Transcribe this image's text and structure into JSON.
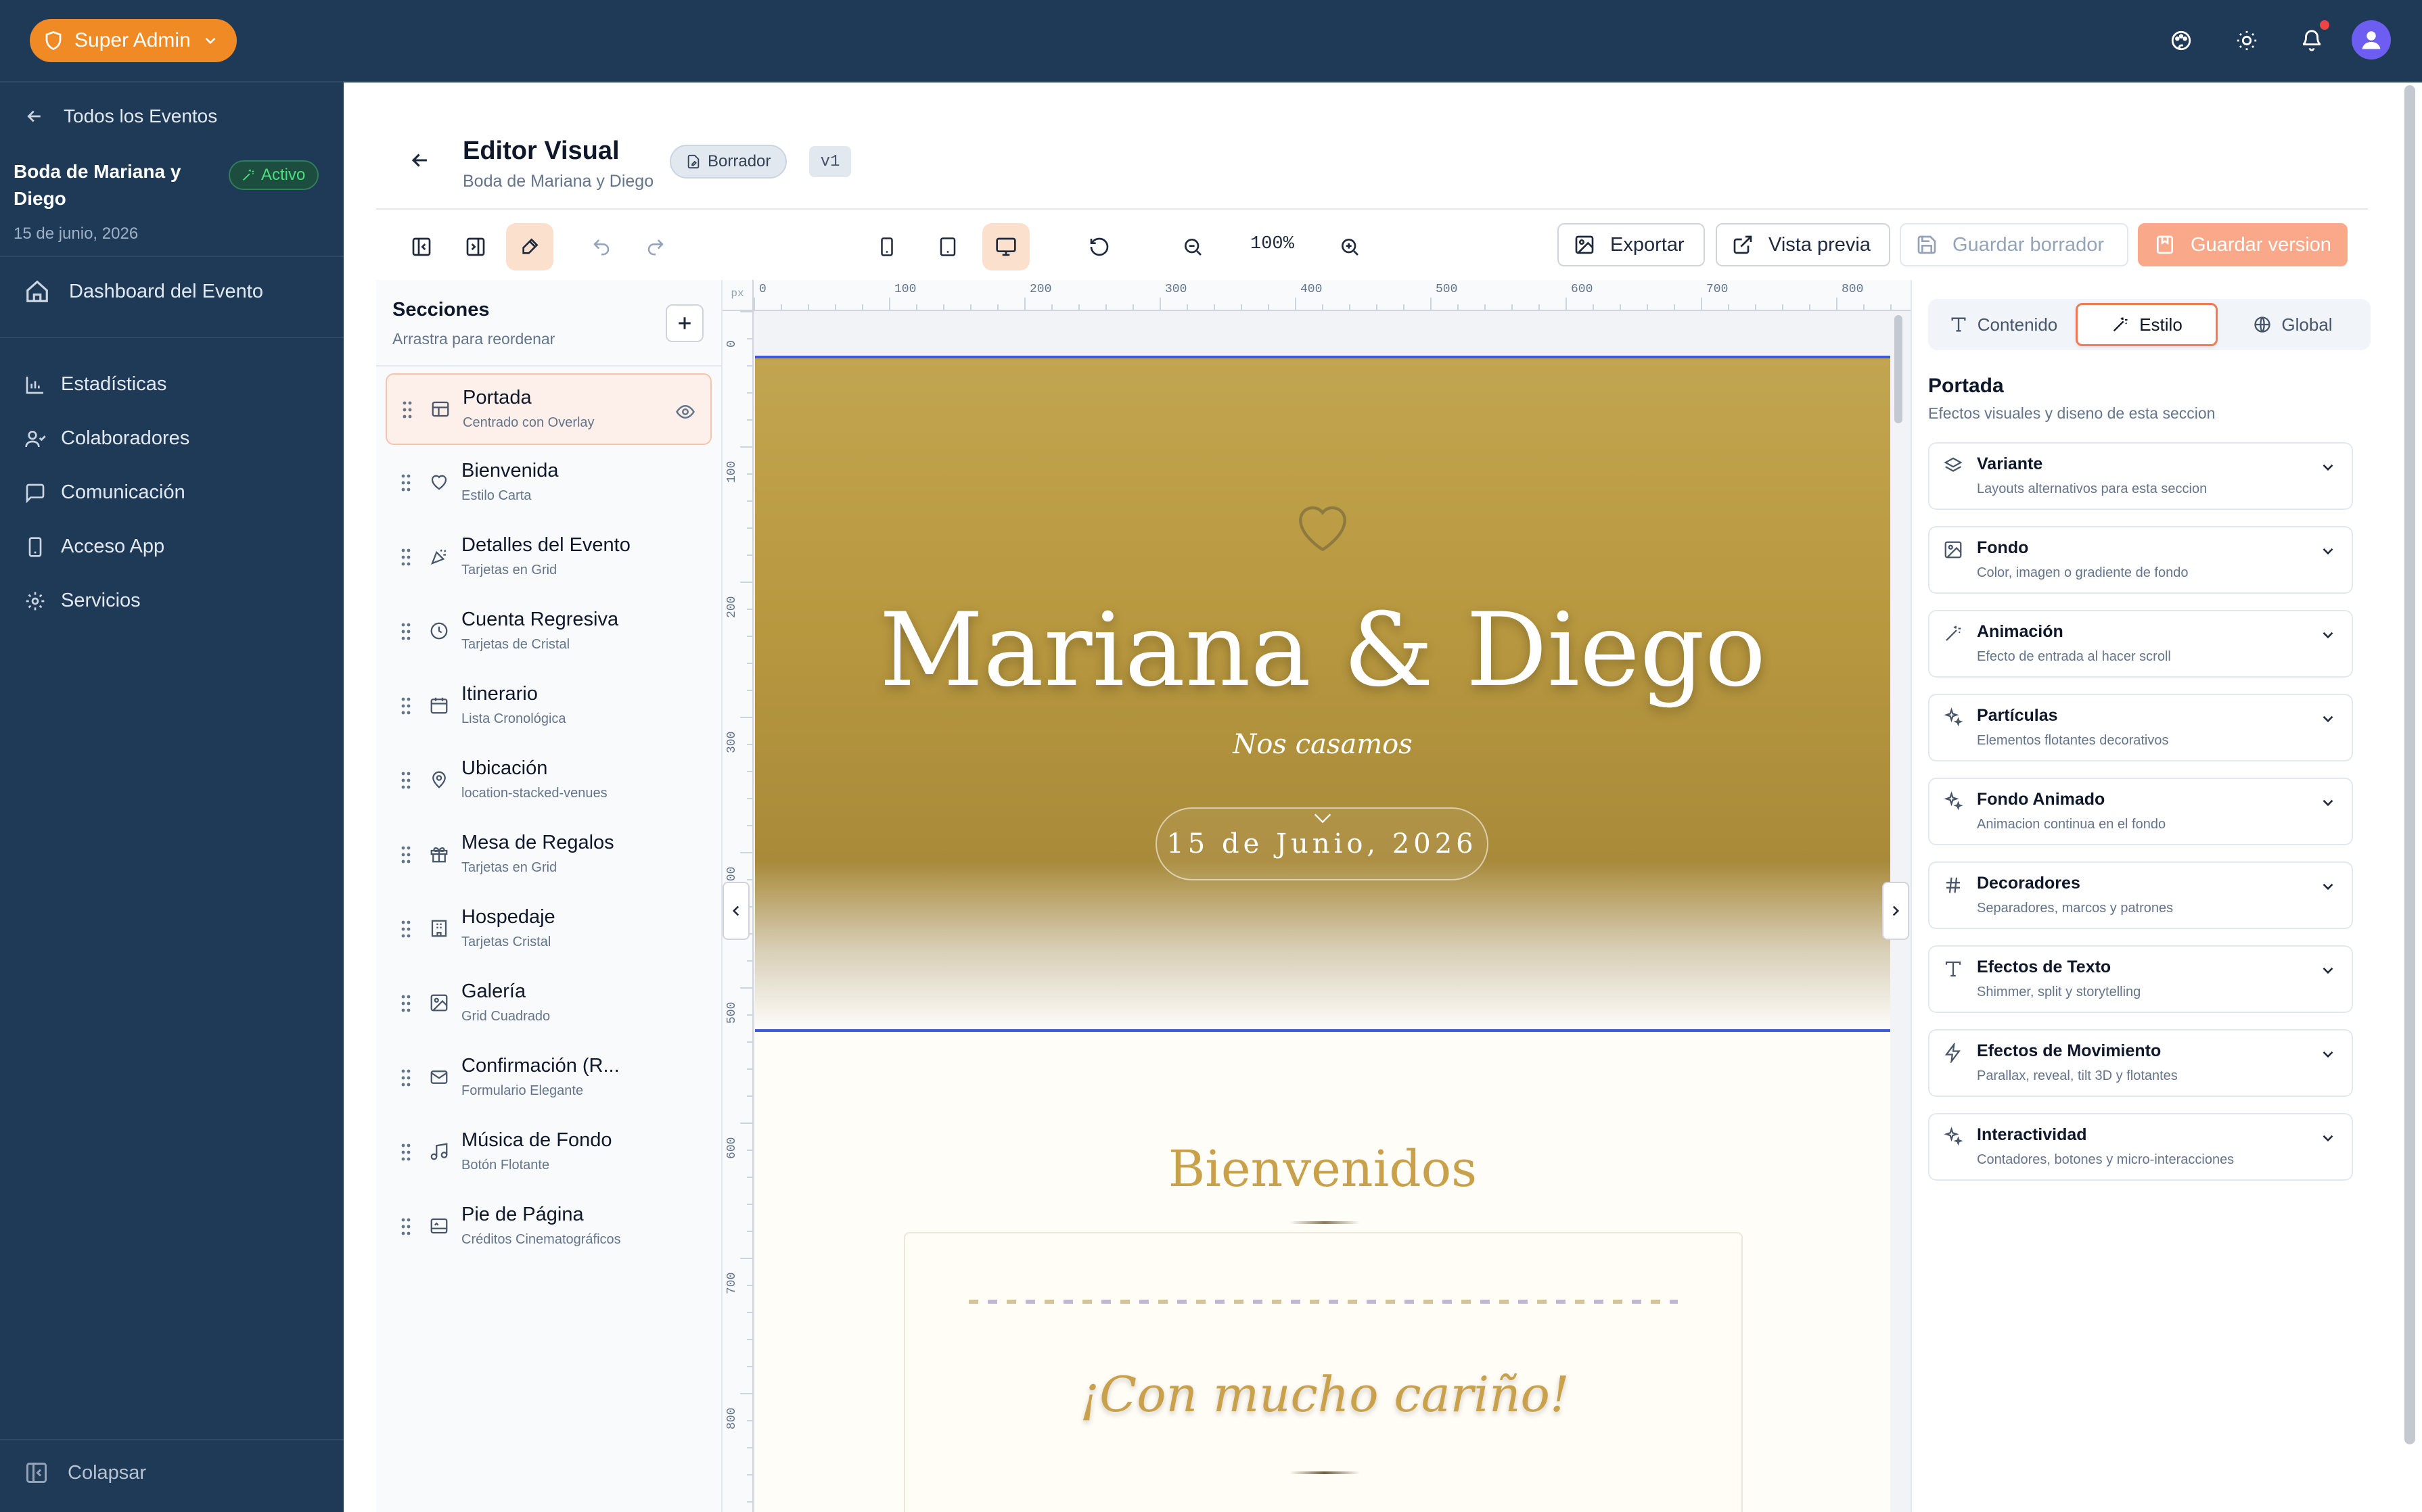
{
  "topbar": {
    "admin_label": "Super Admin",
    "icons": [
      "palette-icon",
      "sun-icon",
      "bell-icon",
      "user-avatar"
    ]
  },
  "sidebar": {
    "back_label": "Todos los Eventos",
    "event_name": "Boda de Mariana y Diego",
    "status": "Activo",
    "event_date": "15 de junio, 2026",
    "dashboard_label": "Dashboard del Evento",
    "items": [
      {
        "label": "Estadísticas",
        "icon": "chart-icon"
      },
      {
        "label": "Colaboradores",
        "icon": "users-icon"
      },
      {
        "label": "Comunicación",
        "icon": "message-icon"
      },
      {
        "label": "Acceso App",
        "icon": "phone-icon"
      },
      {
        "label": "Servicios",
        "icon": "gear-icon"
      }
    ],
    "collapse_label": "Colapsar"
  },
  "editor": {
    "title": "Editor Visual",
    "subtitle": "Boda de Mariana y Diego",
    "status_chip": "Borrador",
    "version_chip": "v1",
    "zoom": "100%",
    "export_label": "Exportar",
    "preview_label": "Vista previa",
    "save_draft_label": "Guardar borrador",
    "save_version_label": "Guardar version"
  },
  "sections_panel": {
    "title": "Secciones",
    "subtitle": "Arrastra para reordenar",
    "items": [
      {
        "name": "Portada",
        "variant": "Centrado con Overlay",
        "icon": "layout-icon",
        "selected": true
      },
      {
        "name": "Bienvenida",
        "variant": "Estilo Carta",
        "icon": "heart-icon"
      },
      {
        "name": "Detalles del Evento",
        "variant": "Tarjetas en Grid",
        "icon": "party-icon"
      },
      {
        "name": "Cuenta Regresiva",
        "variant": "Tarjetas de Cristal",
        "icon": "clock-icon"
      },
      {
        "name": "Itinerario",
        "variant": "Lista Cronológica",
        "icon": "calendar-icon"
      },
      {
        "name": "Ubicación",
        "variant": "location-stacked-venues",
        "icon": "pin-icon"
      },
      {
        "name": "Mesa de Regalos",
        "variant": "Tarjetas en Grid",
        "icon": "gift-icon"
      },
      {
        "name": "Hospedaje",
        "variant": "Tarjetas Cristal",
        "icon": "building-icon"
      },
      {
        "name": "Galería",
        "variant": "Grid Cuadrado",
        "icon": "image-icon"
      },
      {
        "name": "Confirmación (R...",
        "variant": "Formulario Elegante",
        "icon": "mail-icon"
      },
      {
        "name": "Música de Fondo",
        "variant": "Botón Flotante",
        "icon": "music-icon"
      },
      {
        "name": "Pie de Página",
        "variant": "Créditos Cinematográficos",
        "icon": "footer-icon"
      }
    ]
  },
  "canvas": {
    "ruler_unit": "px",
    "ruler_top": [
      "0",
      "100",
      "200",
      "300",
      "400",
      "500",
      "600",
      "700",
      "800"
    ],
    "ruler_left": [
      "0",
      "100",
      "200",
      "300",
      "400",
      "500",
      "600",
      "700",
      "800"
    ],
    "hero_names": "Mariana & Diego",
    "hero_subtitle": "Nos casamos",
    "hero_date": "15 de Junio, 2026",
    "welcome_title": "Bienvenidos",
    "welcome_card_text": "¡Con mucho cariño!"
  },
  "style_panel": {
    "tabs": [
      "Contenido",
      "Estilo",
      "Global"
    ],
    "active_tab": "Estilo",
    "section_title": "Portada",
    "section_subtitle": "Efectos visuales y diseno de esta seccion",
    "groups": [
      {
        "name": "Variante",
        "desc": "Layouts alternativos para esta seccion",
        "icon": "layers-icon"
      },
      {
        "name": "Fondo",
        "desc": "Color, imagen o gradiente de fondo",
        "icon": "image-icon"
      },
      {
        "name": "Animación",
        "desc": "Efecto de entrada al hacer scroll",
        "icon": "wand-icon"
      },
      {
        "name": "Partículas",
        "desc": "Elementos flotantes decorativos",
        "icon": "sparkles-icon"
      },
      {
        "name": "Fondo Animado",
        "desc": "Animacion continua en el fondo",
        "icon": "sparkles-icon"
      },
      {
        "name": "Decoradores",
        "desc": "Separadores, marcos y patrones",
        "icon": "hash-icon"
      },
      {
        "name": "Efectos de Texto",
        "desc": "Shimmer, split y storytelling",
        "icon": "type-icon"
      },
      {
        "name": "Efectos de Movimiento",
        "desc": "Parallax, reveal, tilt 3D y flotantes",
        "icon": "zap-icon"
      },
      {
        "name": "Interactividad",
        "desc": "Contadores, botones y micro-interacciones",
        "icon": "sparkles-icon"
      }
    ]
  },
  "colors": {
    "sidebar_bg": "#1f3a57",
    "accent": "#f08a24",
    "hero_gold": "#b8983f",
    "active_tab_border": "#f07a54"
  }
}
